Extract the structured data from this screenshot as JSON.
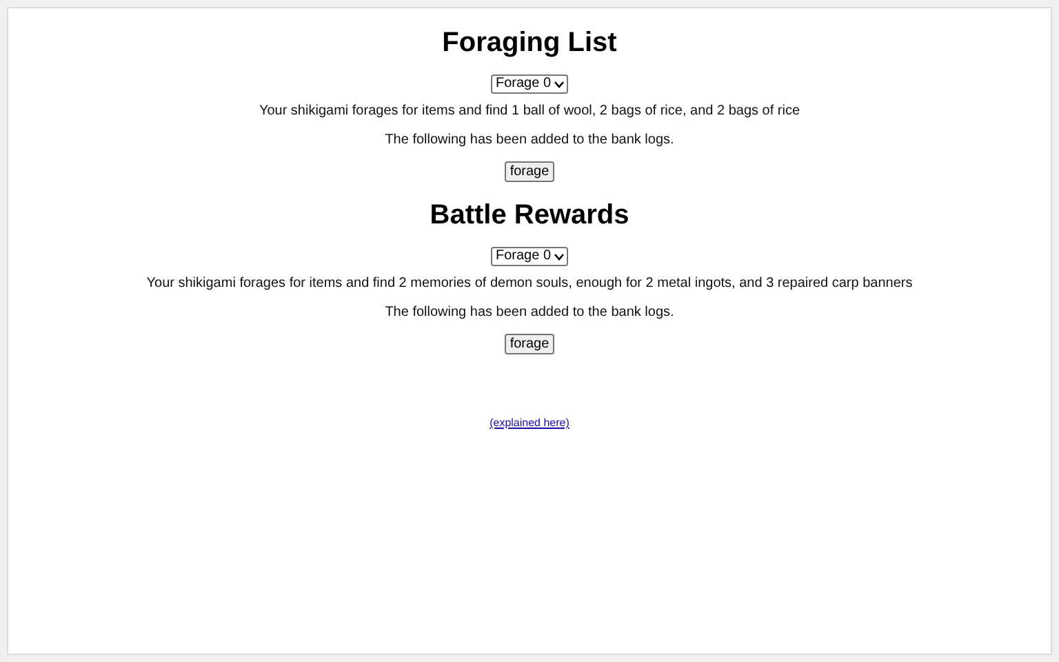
{
  "sections": [
    {
      "title": "Foraging List",
      "dropdown": {
        "value": "Forage 0"
      },
      "result": "Your shikigami forages for items and find 1 ball of wool, 2 bags of rice, and 2 bags of rice",
      "note": "The following has been added to the bank logs.",
      "button": "forage"
    },
    {
      "title": "Battle Rewards",
      "dropdown": {
        "value": "Forage 0"
      },
      "result": "Your shikigami forages for items and find 2 memories of demon souls, enough for 2 metal ingots, and 3 repaired carp banners",
      "note": "The following has been added to the bank logs.",
      "button": "forage"
    }
  ],
  "footer_link": "(explained here)"
}
